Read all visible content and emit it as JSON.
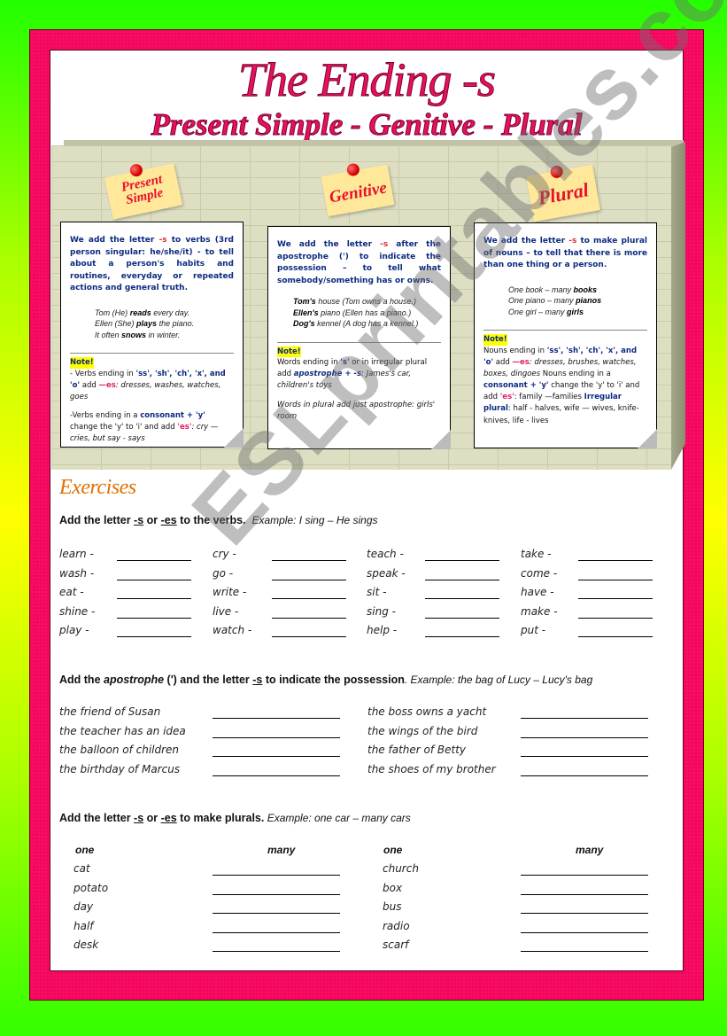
{
  "header": {
    "title": "The Ending -s",
    "subtitle": "Present Simple - Genitive - Plural"
  },
  "notes": {
    "present_simple": [
      "Present",
      "Simple"
    ],
    "genitive": "Genitive",
    "plural": "Plural"
  },
  "cards": {
    "present_simple": {
      "intro_pre": "We add the letter ",
      "intro_s": "-s",
      "intro_post": " to verbs (3rd person singular: he/she/it) - to tell about a person's habits and routines, everyday or repeated actions and general truth.",
      "examples": [
        {
          "pre": "Tom (He) ",
          "word": "read",
          "end": "s",
          "post": " every day."
        },
        {
          "pre": "Ellen (She) ",
          "word": "play",
          "end": "s",
          "post": " the piano."
        },
        {
          "pre": "It often ",
          "word": "snow",
          "end": "s",
          "post": " in winter."
        }
      ],
      "note_label": "Note!",
      "rule1_a": "- Verbs ending in ",
      "rule1_endings": "'ss', 'sh', 'ch', 'x', and 'o'",
      "rule1_b": " add ",
      "rule1_es": "—es",
      "rule1_examples": ": dresses, washes, watches, goes",
      "rule2_a": "-Verbs ending in a ",
      "rule2_consonant": "consonant + 'y'",
      "rule2_b": " change the 'y' to 'i' and add ",
      "rule2_es": "'es'",
      "rule2_examples": ": cry — cries, but say - says"
    },
    "genitive": {
      "intro_pre": "We add the letter ",
      "intro_s": "-s",
      "intro_post": " after the apostrophe (') to indicate the possession – to tell what somebody/something has or owns.",
      "examples": [
        {
          "word": "Tom",
          "end": "'s",
          "post": " house (Tom owns a house.)"
        },
        {
          "word": "Ellen",
          "end": "'s",
          "post": " piano (Ellen has a piano.)"
        },
        {
          "word": "Dog",
          "end": "'s",
          "post": " kennel (A dog has a kennel.)"
        }
      ],
      "note_label": "Note!",
      "rule1_a": "Words ending in ",
      "rule1_s": "'s'",
      "rule1_b": " or in irregular plural add ",
      "rule1_apos": "apostrophe + -s",
      "rule1_examples": ": James's car, children's toys",
      "rule2": "Words in plural add just apostrophe: girls' room"
    },
    "plural": {
      "intro_pre": "We add the letter ",
      "intro_s": "-s",
      "intro_post": " to make plural of nouns – to tell that there is more than one thing or a person.",
      "examples": [
        {
          "pre": "One book – many ",
          "word": "book",
          "end": "s"
        },
        {
          "pre": "One piano – many ",
          "word": "piano",
          "end": "s"
        },
        {
          "pre": "One girl – many ",
          "word": "girl",
          "end": "s"
        }
      ],
      "note_label": "Note!",
      "rule1_a": "Nouns ending in ",
      "rule1_endings": "'ss', 'sh', 'ch', 'x', and 'o'",
      "rule1_b": " add ",
      "rule1_es": "—es",
      "rule1_examples": ": dresses, brushes, watches, boxes, dingoes",
      "rule2_a": "Nouns ending in a ",
      "rule2_consonant": "consonant + 'y'",
      "rule2_b": " change the 'y' to 'i' and add ",
      "rule2_es": "'es'",
      "rule2_examples": ": family —families",
      "rule3_label": "Irregular plural",
      "rule3_text": ": half - halves, wife — wives, knife- knives, life - lives"
    }
  },
  "exercises": {
    "title": "Exercises",
    "ex1": {
      "instr_a": "Add the letter ",
      "instr_s": "-s",
      "instr_or": " or ",
      "instr_es": "-es",
      "instr_b": " to the verbs.",
      "example": "Example: I sing – He sings",
      "columns": [
        [
          "learn -",
          "wash -",
          "eat -",
          "shine -",
          "play -"
        ],
        [
          "cry -",
          "go -",
          "write -",
          "live -",
          "watch -"
        ],
        [
          "teach -",
          "speak -",
          "sit -",
          "sing -",
          "help -"
        ],
        [
          "take -",
          "come -",
          "have -",
          "make -",
          "put -"
        ]
      ]
    },
    "ex2": {
      "instr_a": "Add the ",
      "instr_apos": "apostrophe",
      "instr_b": " (') and the letter ",
      "instr_s": "-s",
      "instr_c": " to indicate the possession",
      "example": ". Example: the bag of Lucy – Lucy's bag",
      "columns": [
        [
          "the friend of Susan",
          "the teacher has an idea",
          "the balloon of children",
          "the birthday of Marcus"
        ],
        [
          "the boss owns a yacht",
          "the wings of the bird",
          "the father of Betty",
          "the shoes of my brother"
        ]
      ]
    },
    "ex3": {
      "instr_a": "Add the letter ",
      "instr_s": "-s",
      "instr_or": " or ",
      "instr_es": "-es",
      "instr_b": " to make plurals.",
      "example": " Example: one car – many cars",
      "head_one": "one",
      "head_many": "many",
      "columns": [
        [
          "cat",
          "potato",
          "day",
          "half",
          "desk"
        ],
        [
          "church",
          "box",
          "bus",
          "radio",
          "scarf"
        ]
      ]
    }
  },
  "watermark": "ESLprintables.com"
}
